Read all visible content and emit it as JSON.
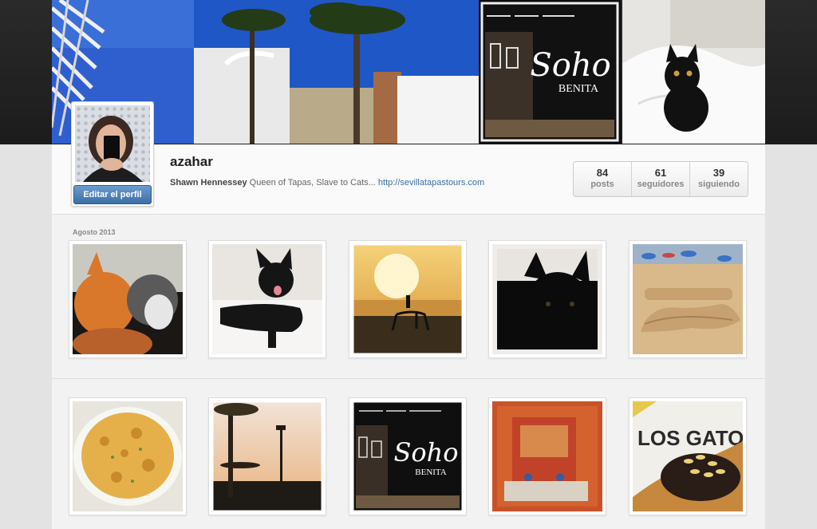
{
  "profile": {
    "username": "azahar",
    "full_name": "Shawn Hennessey",
    "bio": "Queen of Tapas, Slave to Cats...",
    "website": "http://sevillatapastours.com",
    "edit_button": "Editar el perfil"
  },
  "stats": [
    {
      "value": "84",
      "label": "posts"
    },
    {
      "value": "61",
      "label": "seguidores"
    },
    {
      "value": "39",
      "label": "siguiendo"
    }
  ],
  "feed": {
    "month_label": "Agosto 2013"
  },
  "banner": {
    "sign_text": "Soho",
    "sign_sub": "BENITA"
  },
  "photos": {
    "soho_text": "Soho",
    "soho_sub": "BENITA",
    "cerveceria_text": "LOS GATOS"
  },
  "colors": {
    "link": "#3a6ea5",
    "button": "#4a7db5"
  }
}
